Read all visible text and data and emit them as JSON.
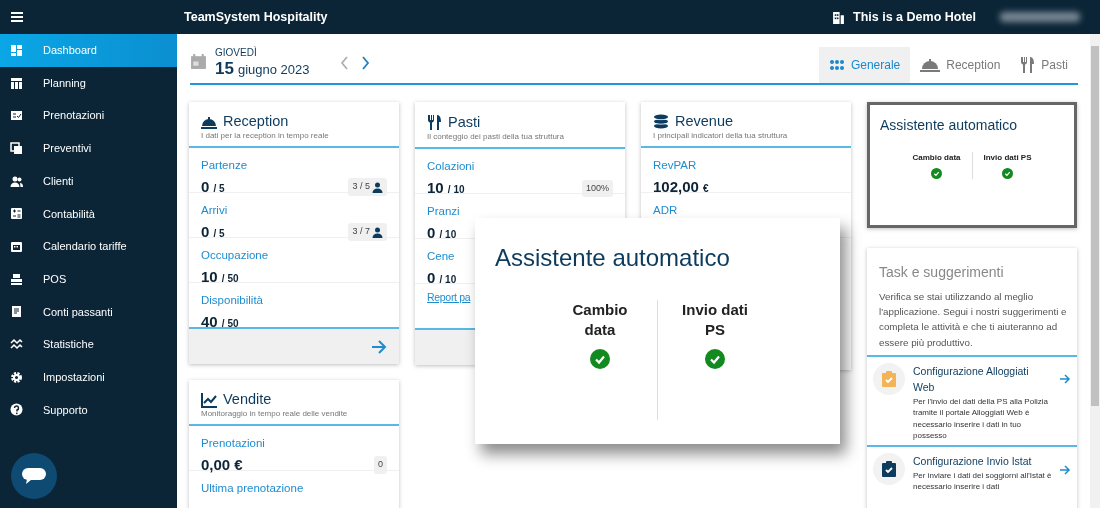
{
  "topbar": {
    "title": "TeamSystem Hospitality",
    "hotel": "This is a Demo Hotel"
  },
  "sidebar": {
    "items": [
      {
        "label": "Dashboard",
        "selected": true
      },
      {
        "label": "Planning",
        "selected": false
      },
      {
        "label": "Prenotazioni",
        "selected": false
      },
      {
        "label": "Preventivi",
        "selected": false
      },
      {
        "label": "Clienti",
        "selected": false
      },
      {
        "label": "Contabilità",
        "selected": false
      },
      {
        "label": "Calendario tariffe",
        "selected": false
      },
      {
        "label": "POS",
        "selected": false
      },
      {
        "label": "Conti passanti",
        "selected": false
      },
      {
        "label": "Statistiche",
        "selected": false
      },
      {
        "label": "Impostazioni",
        "selected": false
      },
      {
        "label": "Supporto",
        "selected": false
      }
    ]
  },
  "date": {
    "weekday": "GIOVEDÌ",
    "day": "15",
    "month_year": "giugno 2023"
  },
  "tabs": [
    {
      "label": "Generale",
      "selected": true
    },
    {
      "label": "Reception",
      "selected": false
    },
    {
      "label": "Pasti",
      "selected": false
    }
  ],
  "reception": {
    "title": "Reception",
    "subtitle": "I dati per la reception in tempo reale",
    "rows": [
      {
        "label": "Partenze",
        "value": "0",
        "total": "/ 5",
        "badge": "3 / 5"
      },
      {
        "label": "Arrivi",
        "value": "0",
        "total": "/ 5",
        "badge": "3 / 7"
      },
      {
        "label": "Occupazione",
        "value": "10",
        "total": "/ 50"
      },
      {
        "label": "Disponibilità",
        "value": "40",
        "total": "/ 50"
      }
    ]
  },
  "pasti": {
    "title": "Pasti",
    "subtitle": "Il conteggio dei pasti della tua struttura",
    "rows": [
      {
        "label": "Colazioni",
        "value": "10",
        "total": "/ 10",
        "badge": "100%"
      },
      {
        "label": "Pranzi",
        "value": "0",
        "total": "/ 10"
      },
      {
        "label": "Cene",
        "value": "0",
        "total": "/ 10"
      }
    ],
    "link": "Report pa"
  },
  "revenue": {
    "title": "Revenue",
    "subtitle": "I principali indicatori della tua struttura",
    "rows": [
      {
        "label": "RevPAR",
        "value": "102,00",
        "total": "€"
      },
      {
        "label": "ADR"
      }
    ]
  },
  "vendite": {
    "title": "Vendite",
    "subtitle": "Monitoraggio in tempo reale delle vendite",
    "rows": [
      {
        "label": "Prenotazioni",
        "value": "0,00 €",
        "badge": "0"
      },
      {
        "label": "Ultima prenotazione"
      }
    ]
  },
  "assistant": {
    "title": "Assistente automatico",
    "items": [
      {
        "label": "Cambio data",
        "ok": true
      },
      {
        "label": "Invio dati PS",
        "ok": true
      }
    ]
  },
  "callout": {
    "title": "Assistente automatico",
    "items": [
      {
        "label": "Cambio data",
        "ok": true
      },
      {
        "label": "Invio dati PS",
        "ok": true
      }
    ]
  },
  "tasks": {
    "title": "Task e suggerimenti",
    "text": "Verifica se stai utilizzando al meglio l'applicazione. Segui i nostri suggerimenti e completa le attività e che ti aiuteranno ad essere più produttivo.",
    "items": [
      {
        "title": "Configurazione Alloggiati Web",
        "text": "Per l'invio dei dati della PS alla Polizia tramite il portale Alloggiati Web è necessario inserire i dati in tuo possesso",
        "color": "#f2b457"
      },
      {
        "title": "Configurazione Invio Istat",
        "text": "Per inviare i dati dei soggiorni all'Istat è necessario inserire i dati",
        "color": "#0d3b5e"
      }
    ]
  }
}
